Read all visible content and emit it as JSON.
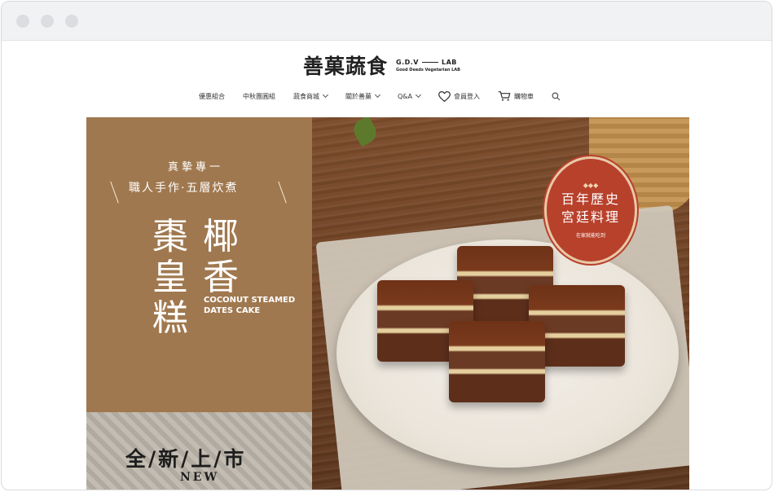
{
  "logo": {
    "cn": "善菓蔬食",
    "en_top_left": "G.D.V",
    "en_top_right": "LAB",
    "en_sub": "Good Deeds Vegetarian LAB"
  },
  "nav": {
    "items": [
      {
        "label": "優惠組合"
      },
      {
        "label": "中秋團圓組"
      },
      {
        "label": "蔬食商城"
      },
      {
        "label": "關於善菓"
      },
      {
        "label": "Q&A"
      }
    ],
    "login": "會員登入",
    "cart": "購物車"
  },
  "hero": {
    "tagline_top": "真摯專一",
    "tagline_main": "職人手作·五層炊煮",
    "title_left": "棗皇糕",
    "title_right": "椰香",
    "title_en_line1": "COCONUT STEAMED",
    "title_en_line2": "DATES CAKE",
    "launch": "全/新/上/市",
    "new_en": "NEW",
    "badge_line1": "百年歷史",
    "badge_line2": "宮廷料理",
    "badge_small": "在家就能吃到",
    "badge_diamonds": "◆◆◆"
  },
  "colors": {
    "panel": "#a0784f",
    "badge": "#b8412c"
  }
}
